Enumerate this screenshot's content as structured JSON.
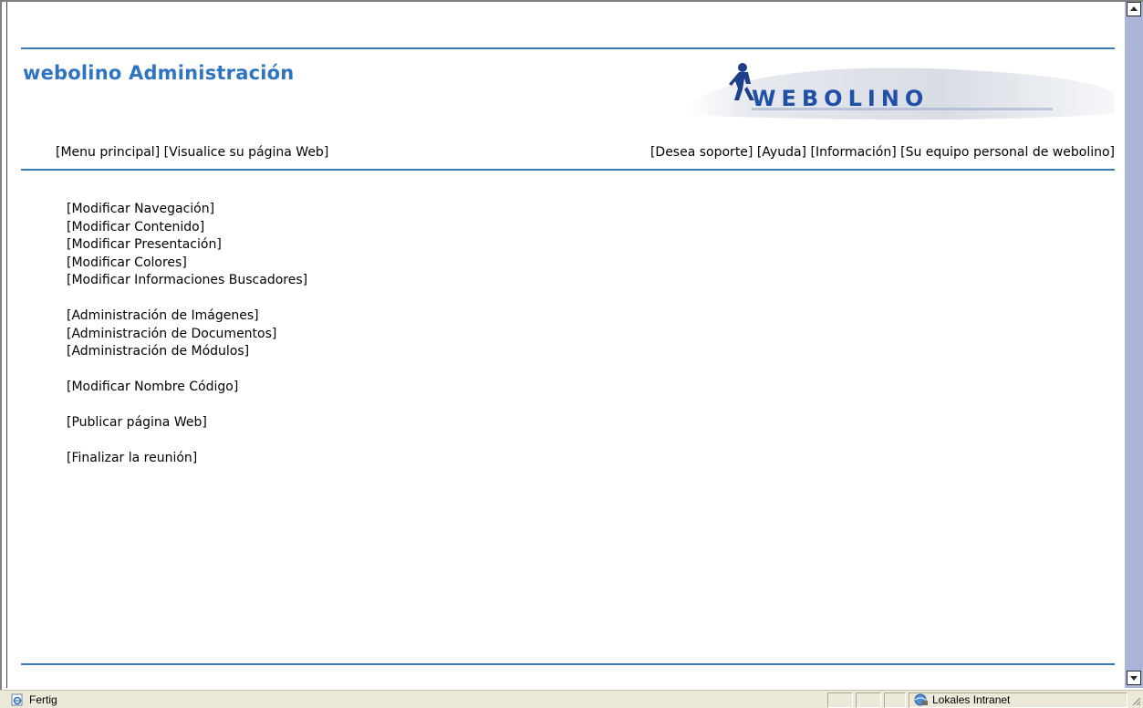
{
  "header": {
    "title": "webolino Administración",
    "logo_text": "WEBOLINO"
  },
  "nav_left": [
    "[Menu principal]",
    "[Visualice su página Web]"
  ],
  "nav_right": [
    "[Desea soporte]",
    "[Ayuda]",
    "[Información]",
    "[Su equipo personal de webolino]"
  ],
  "menu": {
    "group1": [
      "[Modificar Navegación]",
      "[Modificar Contenido]",
      "[Modificar Presentación]",
      "[Modificar Colores]",
      "[Modificar Informaciones Buscadores]"
    ],
    "group2": [
      "[Administración de Imágenes]",
      "[Administración de Documentos]",
      "[Administración de Módulos]"
    ],
    "group3": [
      "[Modificar Nombre Código]"
    ],
    "group4": [
      "[Publicar página Web]"
    ],
    "group5": [
      "[Finalizar la reunión]"
    ]
  },
  "statusbar": {
    "status": "Fertig",
    "zone": "Lokales Intranet"
  },
  "colors": {
    "accent": "#2f74c0",
    "rule": "#3a7ab8",
    "scrollbar": "#a9b4d8",
    "statusbar": "#ece9d8"
  },
  "icons": [
    "ie-page-icon",
    "intranet-zone-icon",
    "scroll-up-icon",
    "scroll-down-icon",
    "resize-grip-icon"
  ]
}
